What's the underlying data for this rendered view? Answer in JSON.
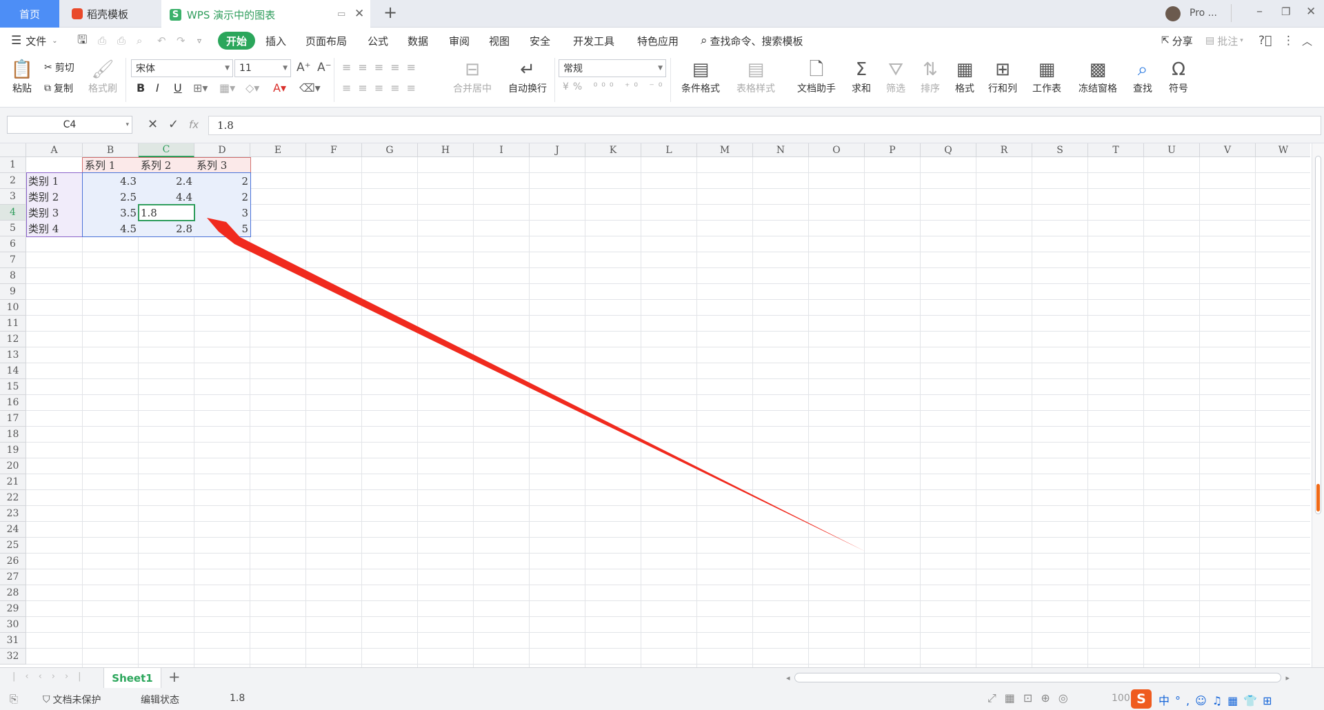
{
  "tabs": {
    "home": "首页",
    "docer": "稻壳模板",
    "wps_doc": "WPS 演示中的图表",
    "user": "Pro ..."
  },
  "menu": {
    "file": "文件",
    "items": [
      "开始",
      "插入",
      "页面布局",
      "公式",
      "数据",
      "审阅",
      "视图",
      "安全",
      "开发工具",
      "特色应用"
    ],
    "search": "查找命令、搜索模板",
    "share": "分享",
    "annotate": "批注"
  },
  "ribbon": {
    "paste": "粘贴",
    "cut": "剪切",
    "copy": "复制",
    "format_painter": "格式刷",
    "font_name": "宋体",
    "font_size": "11",
    "merge_center": "合并居中",
    "wrap_text": "自动换行",
    "number_format": "常规",
    "conditional_format": "条件格式",
    "table_style": "表格样式",
    "doc_assistant": "文档助手",
    "sum": "求和",
    "filter": "筛选",
    "sort": "排序",
    "format": "格式",
    "rows_cols": "行和列",
    "worksheet": "工作表",
    "freeze": "冻结窗格",
    "find": "查找",
    "symbol": "符号"
  },
  "formula_bar": {
    "name_box": "C4",
    "fx": "fx",
    "value": "1.8"
  },
  "columns": [
    "A",
    "B",
    "C",
    "D",
    "E",
    "F",
    "G",
    "H",
    "I",
    "J",
    "K",
    "L",
    "M",
    "N",
    "O",
    "P",
    "Q",
    "R",
    "S",
    "T",
    "U",
    "V",
    "W"
  ],
  "rows": [
    "1",
    "2",
    "3",
    "4",
    "5",
    "6",
    "7",
    "8",
    "9",
    "10",
    "11",
    "12",
    "13",
    "14",
    "15",
    "16",
    "17",
    "18",
    "19",
    "20",
    "21",
    "22",
    "23",
    "24",
    "25",
    "26",
    "27",
    "28",
    "29",
    "30",
    "31",
    "32"
  ],
  "table": {
    "headers": [
      "系列 1",
      "系列 2",
      "系列 3"
    ],
    "row_labels": [
      "类别 1",
      "类别 2",
      "类别 3",
      "类别 4"
    ],
    "values": [
      [
        "4.3",
        "2.4",
        "2"
      ],
      [
        "2.5",
        "4.4",
        "2"
      ],
      [
        "3.5",
        "1.8",
        "3"
      ],
      [
        "4.5",
        "2.8",
        "5"
      ]
    ]
  },
  "sheet_tab": "Sheet1",
  "status": {
    "protection": "文档未保护",
    "mode": "编辑状态",
    "value": "1.8",
    "zoom": "100"
  },
  "colors": {
    "accent_green": "#2ba65b",
    "tab_blue": "#4d8ef6",
    "arrow_red": "#f02a1e"
  }
}
